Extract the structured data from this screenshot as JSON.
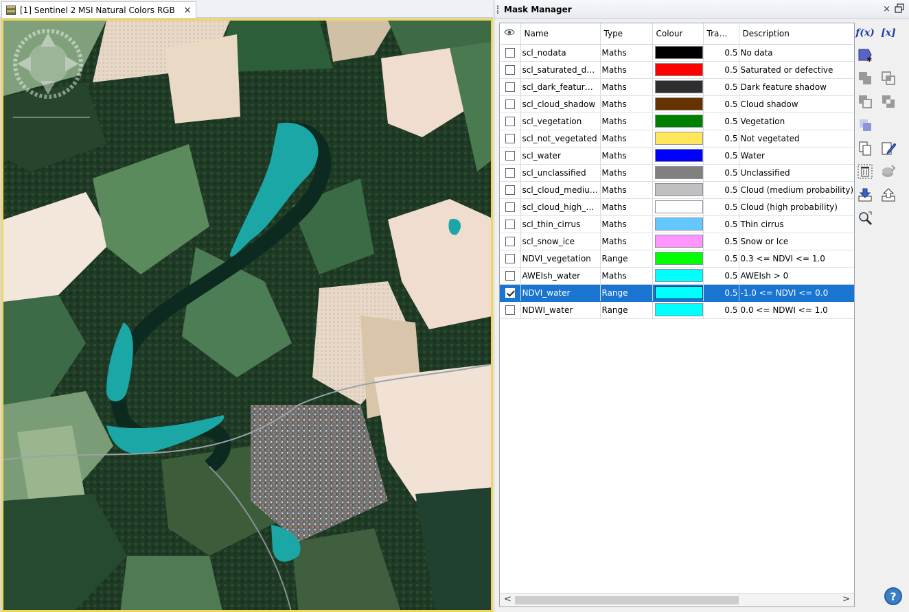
{
  "view": {
    "tab_title": "[1] Sentinel 2 MSI Natural Colors RGB",
    "tab_close": "×"
  },
  "panel": {
    "title": "Mask Manager",
    "close": "×",
    "columns": {
      "visible": "",
      "name": "Name",
      "type": "Type",
      "colour": "Colour",
      "transparency": "Tra…",
      "description": "Description"
    },
    "rows": [
      {
        "checked": false,
        "name": "scl_nodata",
        "type": "Maths",
        "colour": "#000000",
        "transparency": "0.5",
        "description": "No data"
      },
      {
        "checked": false,
        "name": "scl_saturated_d…",
        "type": "Maths",
        "colour": "#ff0000",
        "transparency": "0.5",
        "description": "Saturated or defective"
      },
      {
        "checked": false,
        "name": "scl_dark_featur…",
        "type": "Maths",
        "colour": "#2e2e2e",
        "transparency": "0.5",
        "description": "Dark feature shadow"
      },
      {
        "checked": false,
        "name": "scl_cloud_shadow",
        "type": "Maths",
        "colour": "#663300",
        "transparency": "0.5",
        "description": "Cloud shadow"
      },
      {
        "checked": false,
        "name": "scl_vegetation",
        "type": "Maths",
        "colour": "#008000",
        "transparency": "0.5",
        "description": "Vegetation"
      },
      {
        "checked": false,
        "name": "scl_not_vegetated",
        "type": "Maths",
        "colour": "#ffe65a",
        "transparency": "0.5",
        "description": "Not vegetated"
      },
      {
        "checked": false,
        "name": "scl_water",
        "type": "Maths",
        "colour": "#0000ff",
        "transparency": "0.5",
        "description": "Water"
      },
      {
        "checked": false,
        "name": "scl_unclassified",
        "type": "Maths",
        "colour": "#808080",
        "transparency": "0.5",
        "description": "Unclassified"
      },
      {
        "checked": false,
        "name": "scl_cloud_mediu…",
        "type": "Maths",
        "colour": "#c0c0c0",
        "transparency": "0.5",
        "description": "Cloud (medium probability)"
      },
      {
        "checked": false,
        "name": "scl_cloud_high_…",
        "type": "Maths",
        "colour": "#ffffff",
        "transparency": "0.5",
        "description": "Cloud (high probability)"
      },
      {
        "checked": false,
        "name": "scl_thin_cirrus",
        "type": "Maths",
        "colour": "#64c8ff",
        "transparency": "0.5",
        "description": "Thin cirrus"
      },
      {
        "checked": false,
        "name": "scl_snow_ice",
        "type": "Maths",
        "colour": "#ff96ff",
        "transparency": "0.5",
        "description": "Snow or Ice"
      },
      {
        "checked": false,
        "name": "NDVI_vegetation",
        "type": "Range",
        "colour": "#00ff00",
        "transparency": "0.5",
        "description": "0.3 <= NDVI <= 1.0"
      },
      {
        "checked": false,
        "name": "AWEIsh_water",
        "type": "Maths",
        "colour": "#00ffff",
        "transparency": "0.5",
        "description": "AWEIsh > 0"
      },
      {
        "checked": true,
        "selected": true,
        "name": "NDVI_water",
        "type": "Range",
        "colour": "#00ffff",
        "transparency": "0.5",
        "description": "-1.0 <= NDVI <= 0.0"
      },
      {
        "checked": false,
        "name": "NDWI_water",
        "type": "Range",
        "colour": "#00ffff",
        "transparency": "0.5",
        "description": "0.0 <= NDWI <= 1.0"
      }
    ]
  },
  "toolbar": {
    "fx_label": "f(x)",
    "vars_label": "[x]",
    "help_label": "?",
    "scroll_left": "<",
    "scroll_right": ">"
  },
  "icons": {
    "visibility_column": "eye-icon"
  }
}
